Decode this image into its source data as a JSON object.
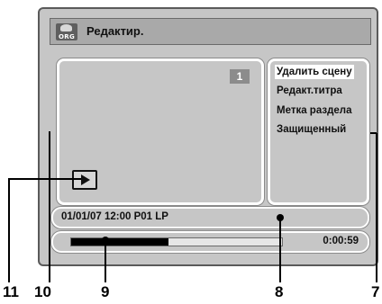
{
  "header": {
    "icon_label": "ORG",
    "title": "Редактир."
  },
  "preview": {
    "scene_number": "1"
  },
  "menu": {
    "items": [
      {
        "label": "Удалить сцену",
        "selected": true
      },
      {
        "label": "Редакт.титра",
        "selected": false
      },
      {
        "label": "Метка раздела",
        "selected": false
      },
      {
        "label": "Защищенный",
        "selected": false
      }
    ]
  },
  "info": {
    "text": "01/01/07 12:00  P01  LP"
  },
  "progress": {
    "fraction": 0.46,
    "time": "0:00:59"
  },
  "callouts": {
    "n11": "11",
    "n10": "10",
    "n9": "9",
    "n8": "8",
    "n7": "7"
  },
  "icons": {
    "header": "org-disc-icon",
    "playback": "play-icon"
  }
}
